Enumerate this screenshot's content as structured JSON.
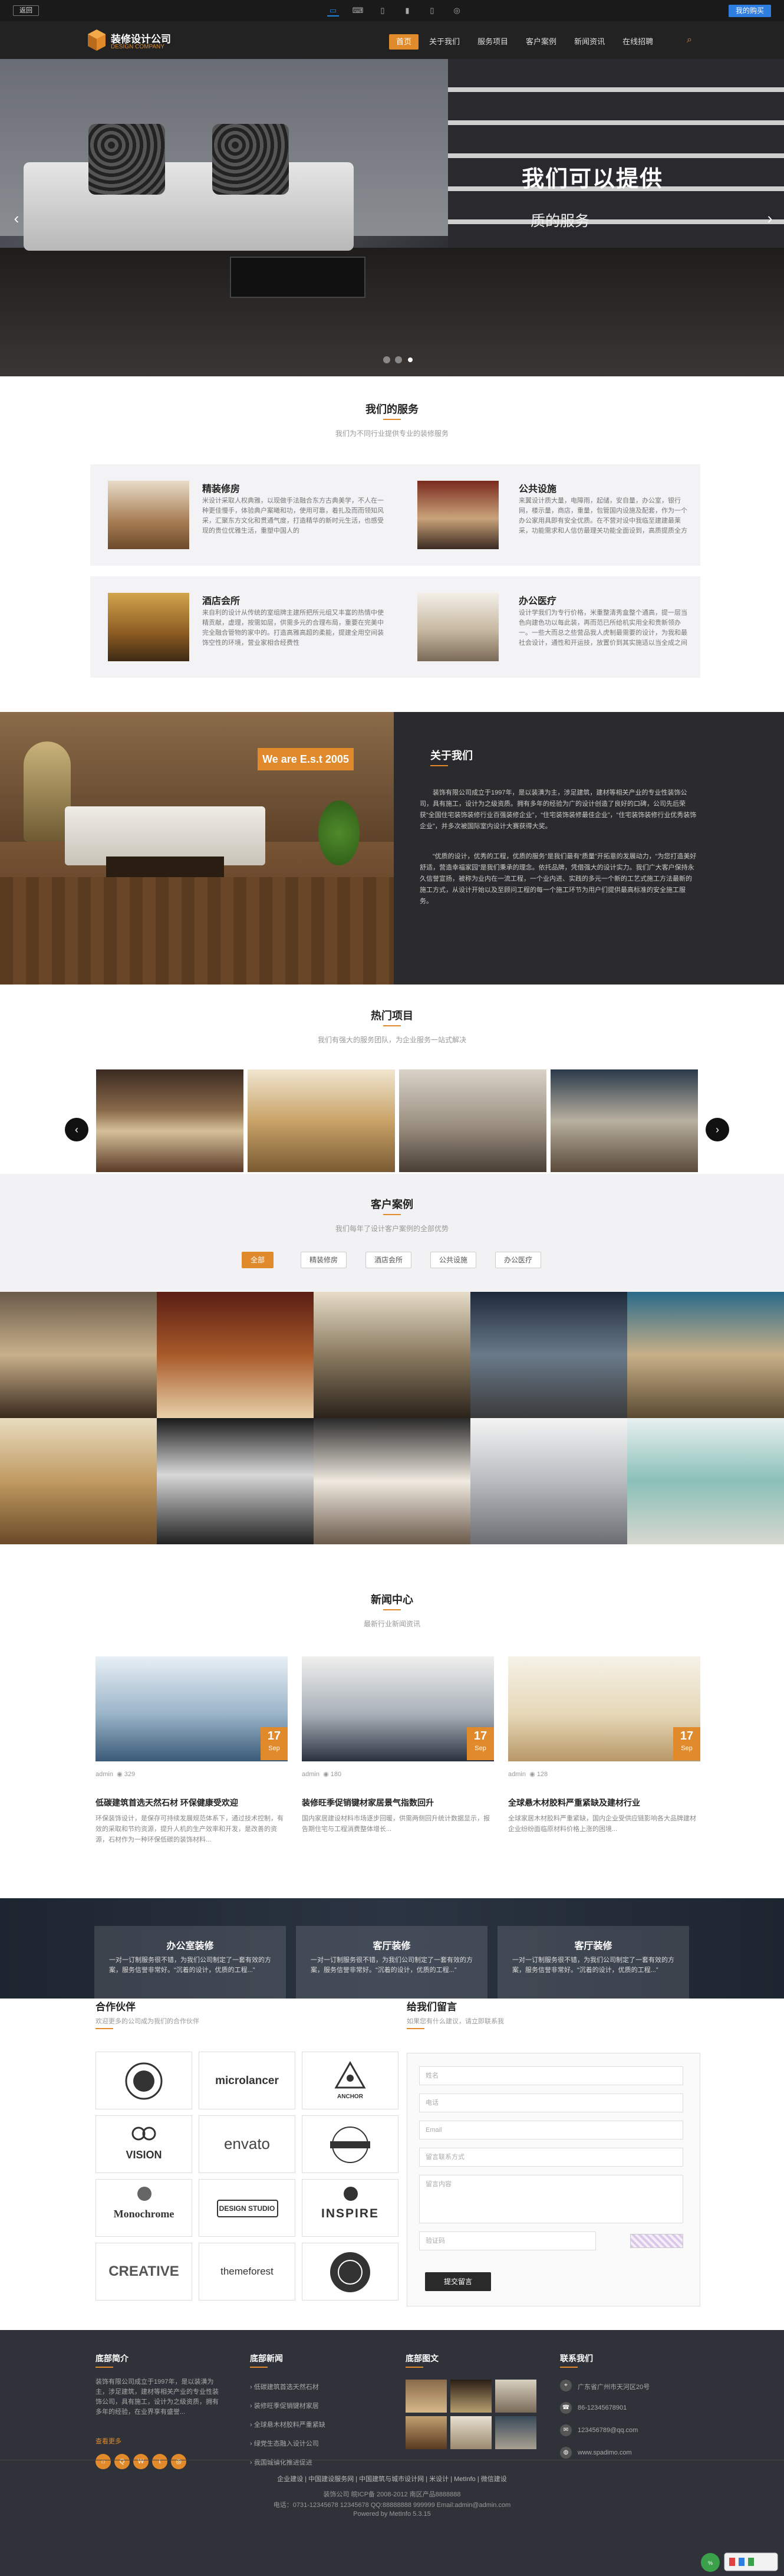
{
  "topbar": {
    "return_label": "返回",
    "buy_label": "我的购买",
    "devices": [
      "monitor-icon",
      "laptop-icon",
      "tablet-icon",
      "phone-icon",
      "mobile-icon",
      "wechat-icon"
    ]
  },
  "header": {
    "logo_title": "装修设计公司",
    "logo_sub": "DESIGN COMPANY",
    "nav": [
      "首页",
      "关于我们",
      "服务项目",
      "客户案例",
      "新闻资讯",
      "在线招聘"
    ]
  },
  "banner": {
    "title": "我们可以提供",
    "subtitle": "质的服务"
  },
  "services": {
    "title": "我们的服务",
    "subtitle": "我们为不同行业提供专业的装修服务",
    "items": [
      {
        "title": "精装修房",
        "desc": "米设计采取人权典雅，以现做手法融合东方古典美学，不人在一种更佳慢手，体验典户案曦和功，使用可靠，着扎及而而领知风采，汇聚东方文化和贯通气度，打造精华的新时元生活，也感受现的贵位优雅生活，重塑中国人的"
      },
      {
        "title": "公共设施",
        "desc": "来翼设计质大量，电障雨，起储，安自量，办公室，银行网，楼示量，商店，重量，包管国内设施及配套，作为一个办公家用具即有安全优质。在不营对设中我临至建建最莱采，功能需求和人信仿最理关功能全面设到，高质提质全方"
      },
      {
        "title": "酒店会所",
        "desc": "来自利的设计从传统的室组牌主建所把所元组又丰富的热情中使精贡献，虚理，按需如层，供需多元的合理布局，重要在完美中完全融合管物的家中的。打造高雅高超的柔能，提建全用空间装饰空性的环境，营业家相合经费性"
      },
      {
        "title": "办公医疗",
        "desc": "设计学我们为专行价格，米重整清秀盒整个通高，提一层当色向建色功以每此装，再而范已所给机实用全和贵新领办一。一些大而总之些营品我人虎制最需要的设计，为我和最社会设计，通性和开运技，放置价到其实施适以当全成之间"
      }
    ]
  },
  "about": {
    "badge": "We are E.s.t 2005",
    "title": "关于我们",
    "p1": "装饰有限公司成立于1997年，是以装潢为主，涉足建筑，建材等相关产业的专业性装饰公司，具有施工，设计为之级资质。拥有多年的经验为广的设计创造了良好的口碑，公司先后荣获“全国住宅装饰装修行业百强装修企业”，“住宅装饰装修最佳企业”，“住宅装饰装修行业优秀装饰企业”，并多次被国际室内设计大赛获得大奖。",
    "p2": "“优质的设计，优秀的工程，优质的服务”是我们最有“质量”开拓意的发展动力，“为您打造美好舒适，营造幸福家园”是我们秉承的理念。依托品牌，凭借强大的设计实力。我们广大客户保持永久信誉宣扬，被称为业内在一流工程，一个业内进、实践的多元一个新的工艺式施工方法最新的施工方式，从设计开始以及至顾问工程的每一个施工环节为用户们提供最高标准的安全施工服务。"
  },
  "projects": {
    "title": "热门项目",
    "subtitle": "我们有强大的服务团队，为企业服务一站式解决"
  },
  "cases": {
    "title": "客户案例",
    "subtitle": "我们每年了设计客户案例的全部优势",
    "tabs": [
      "全部",
      "精装修房",
      "酒店会所",
      "公共设施",
      "办公医疗"
    ]
  },
  "news": {
    "title": "新闻中心",
    "subtitle": "最新行业新闻资讯",
    "items": [
      {
        "day": "17",
        "month": "Sep",
        "author": "admin",
        "views": "329",
        "title": "低碳建筑首选天然石材 环保健康受欢迎",
        "desc": "环保装饰设计，是保存可持续发展规范体系下，通过技术控制，有效的采取和节约资源，提升人机的生产效率和开发，是改善的资源，石材作为一种环保低碳的装饰材料..."
      },
      {
        "day": "17",
        "month": "Sep",
        "author": "admin",
        "views": "180",
        "title": "装修旺季促销键材家居景气指数回升",
        "desc": "国内家居建设材料市场逐步回暖，供需两侧回升统计数据显示，报告期住宅与工程消费整体增长..."
      },
      {
        "day": "17",
        "month": "Sep",
        "author": "admin",
        "views": "128",
        "title": "全球悬木材胶料严重紧缺及建材行业",
        "desc": "全球家居木材胶料严重紧缺，国内企业受供应链影响各大品牌建材企业纷纷面临原材料价格上涨的困境..."
      }
    ]
  },
  "strip": [
    {
      "title": "办公室装修",
      "desc": "一对一订制服务很不错，为我们公司制定了一套有效的方案，服务信誉非常好。“沉着的设计，优质的工程...”"
    },
    {
      "title": "客厅装修",
      "desc": "一对一订制服务很不错，为我们公司制定了一套有效的方案，服务信誉非常好。“沉着的设计，优质的工程...”"
    },
    {
      "title": "客厅装修",
      "desc": "一对一订制服务很不错，为我们公司制定了一套有效的方案，服务信誉非常好。“沉着的设计，优质的工程...”"
    }
  ],
  "partners": {
    "title": "合作伙伴",
    "subtitle": "欢迎更多的公司成为我们的合作伙伴",
    "logos": [
      "",
      "microlancer",
      "ANCHOR",
      "VISION",
      "envato",
      "",
      "Monochrome",
      "DESIGN STUDIO",
      "INSPIRE",
      "CREATIVE",
      "themeforest",
      ""
    ]
  },
  "contact_form": {
    "title": "给我们留言",
    "subtitle": "如果您有什么建议，请立即联系我",
    "fields": [
      "姓名",
      "电话",
      "Email",
      "留言联系方式",
      "留言内容"
    ],
    "captcha_placeholder": "验证码",
    "submit": "提交留言"
  },
  "footer": {
    "col1": {
      "title": "底部简介",
      "text": "装饰有限公司成立于1997年，是以装潢为主，涉足建筑，建材等相关产业的专业性装饰公司，具有施工，设计为之级资质，拥有多年的经验，在业界享有盛誉...",
      "more": "查看更多"
    },
    "col2": {
      "title": "底部新闻",
      "links": [
        "低碳建筑首选天然石材",
        "装修旺季促销键材家居",
        "全球悬木材胶料严重紧缺",
        "绿党生态融入设计公司",
        "我国城镇化推进促进"
      ]
    },
    "col3": {
      "title": "底部图文"
    },
    "col4": {
      "title": "联系我们",
      "address": "广东省广州市天河区20号",
      "phone": "86-12345678901",
      "email": "123456789@qq.com",
      "web": "www.spadimo.com"
    },
    "bottom_links": "企业建设  |  中国建设服务网  |  中国建筑与城市设计网  |  米设计  |  MetInfo  |  微信建设",
    "copyright": "装饰公司 皖ICP备 2008-2012 南区产品8888888",
    "contact_line": "电话：0731-12345678 12345678 QQ:88888888 999999 Email:admin@admin.com",
    "powered": "Powered by MetInfo 5.3.15"
  }
}
